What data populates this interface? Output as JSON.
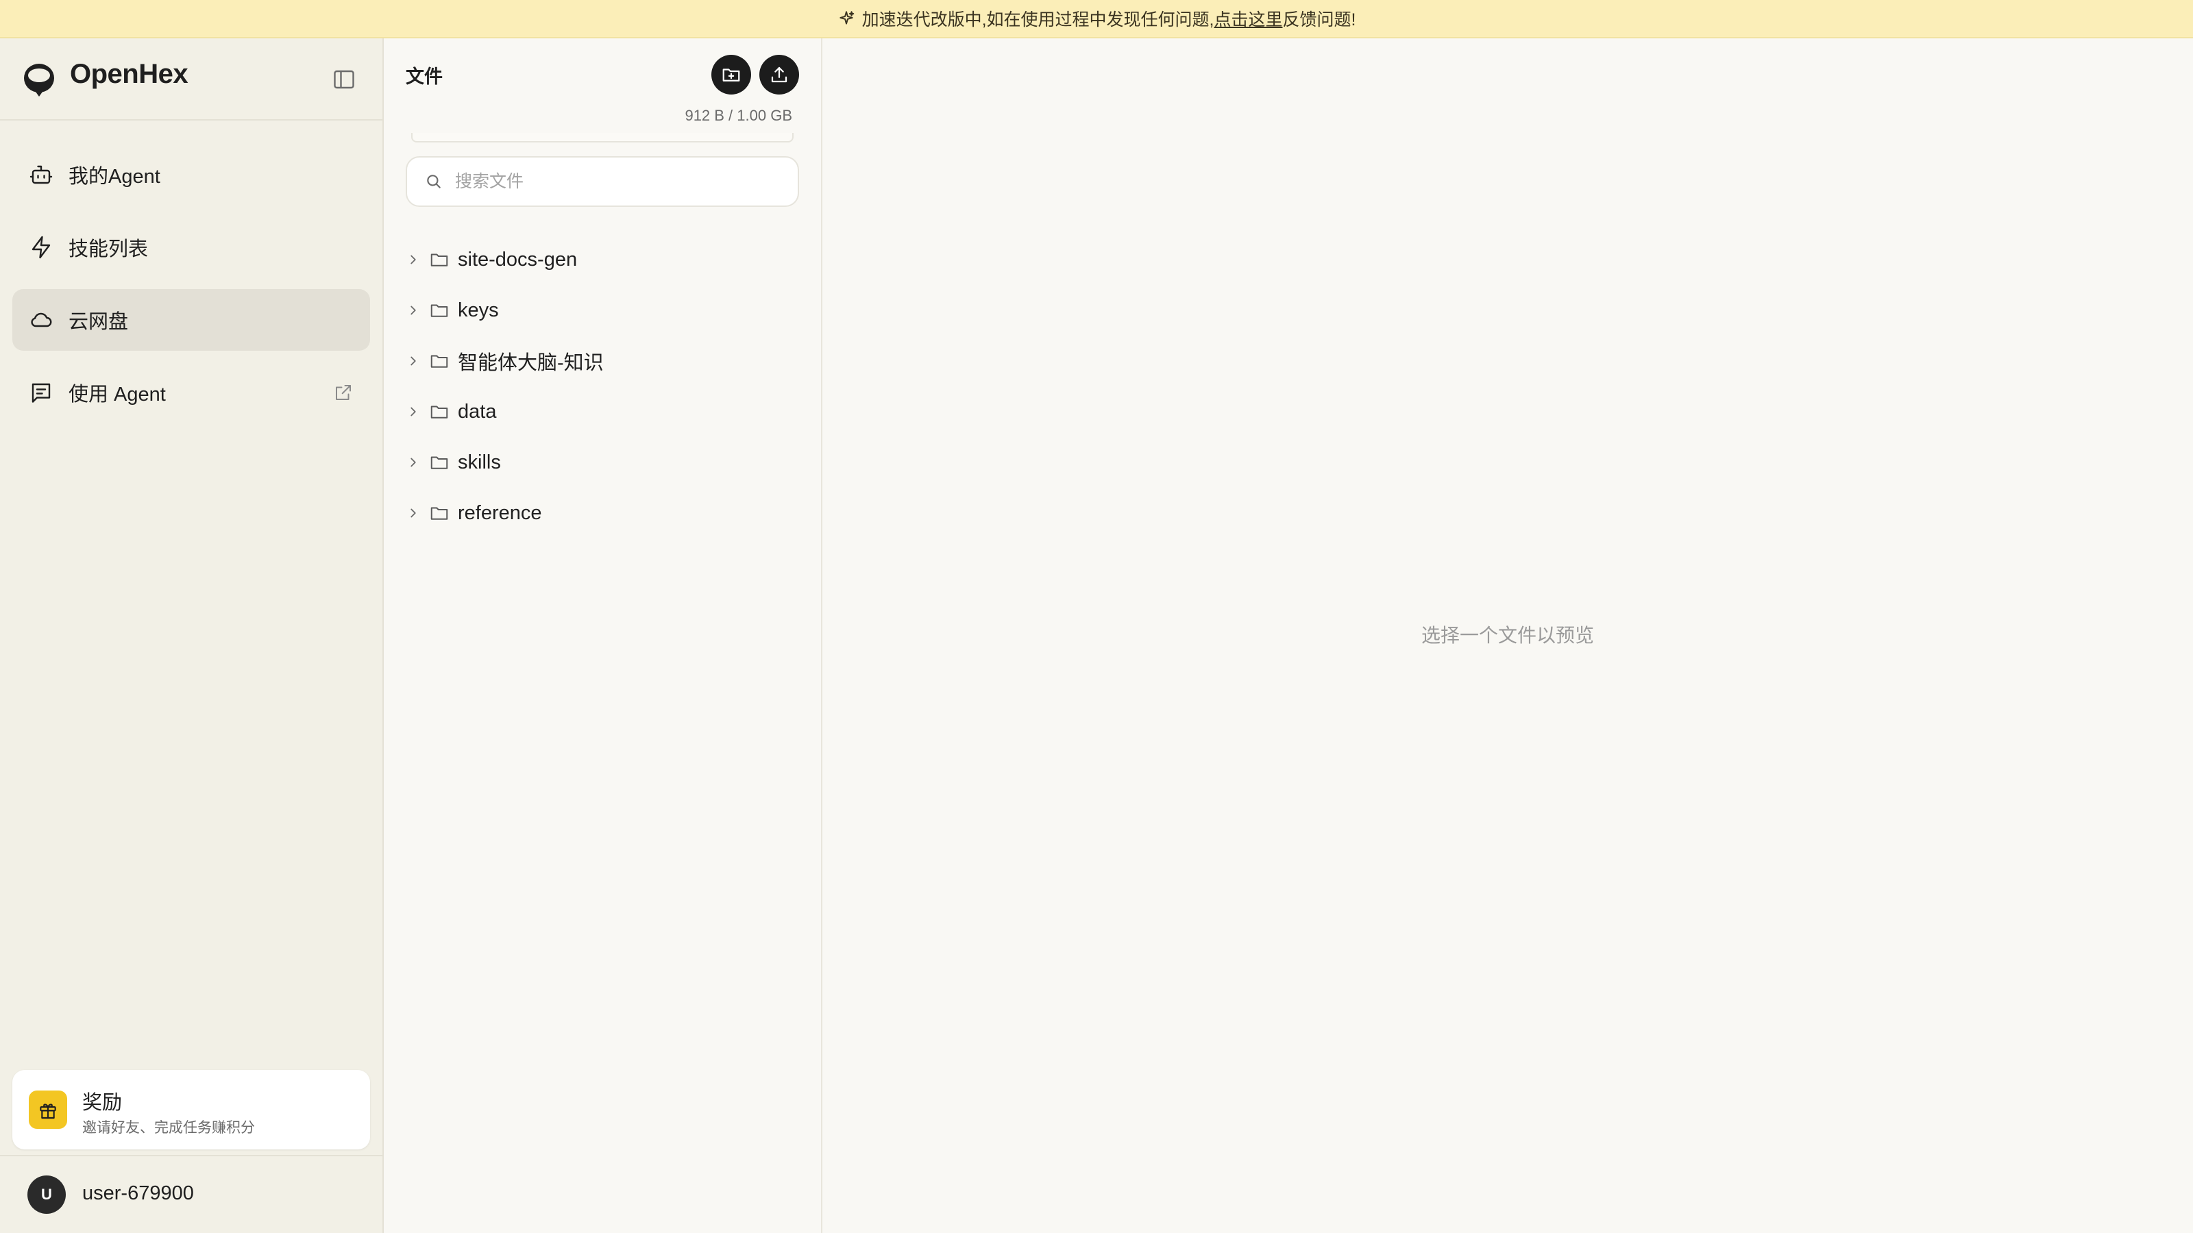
{
  "banner": {
    "text_before": "加速迭代改版中,如在使用过程中发现任何问题,",
    "link": "点击这里",
    "text_after": "反馈问题!",
    "icon": "sparkle-icon"
  },
  "app": {
    "name": "OpenHex"
  },
  "sidebar": {
    "items": [
      {
        "label": "我的Agent",
        "icon": "robot-icon",
        "active": false
      },
      {
        "label": "技能列表",
        "icon": "lightning-icon",
        "active": false
      },
      {
        "label": "云网盘",
        "icon": "cloud-icon",
        "active": true
      },
      {
        "label": "使用 Agent",
        "icon": "chat-icon",
        "active": false,
        "external": true
      }
    ],
    "reward": {
      "title": "奖励",
      "subtitle": "邀请好友、完成任务赚积分"
    },
    "user": {
      "initial": "U",
      "name": "user-679900"
    }
  },
  "files": {
    "title": "文件",
    "usage": "912 B / 1.00 GB",
    "search_placeholder": "搜索文件",
    "items": [
      {
        "name": "site-docs-gen",
        "type": "folder"
      },
      {
        "name": "keys",
        "type": "folder"
      },
      {
        "name": "智能体大脑-知识",
        "type": "folder"
      },
      {
        "name": "data",
        "type": "folder"
      },
      {
        "name": "skills",
        "type": "folder"
      },
      {
        "name": "reference",
        "type": "folder"
      }
    ]
  },
  "preview": {
    "empty_text": "选择一个文件以预览"
  },
  "colors": {
    "banner_bg": "#fbeeb8",
    "sidebar_bg": "#f2f0e6",
    "active_bg": "#e3e0d6",
    "accent_yellow": "#f3c623"
  }
}
